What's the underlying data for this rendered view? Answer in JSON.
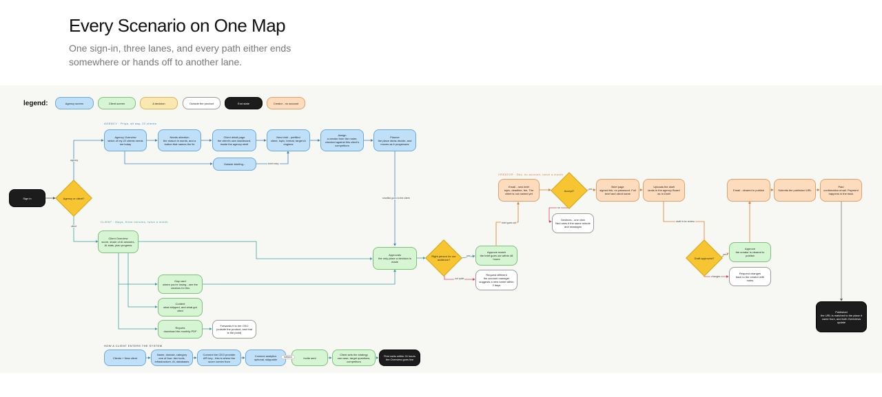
{
  "header": {
    "title": "Every Scenario on One Map",
    "subtitle": "One sign-in, three lanes, and every path either ends somewhere or hands off to another lane."
  },
  "legend": {
    "title": "legend:",
    "items": [
      "Agency screen",
      "Client screen",
      "A decision",
      "Outside the product",
      "End state",
      "Creator - no account"
    ]
  },
  "lanes": {
    "agency": "AGENCY · Priya, all day, 22 clients",
    "client": "CLIENT · Maya, three minutes, twice a month",
    "creator": "CREATOR · Dev, no account, twice a month",
    "how": "HOW A CLIENT ENTERS THE SYSTEM"
  },
  "nodes": {
    "signin": "Sign in",
    "d_agency_client": "Agency or client?",
    "ag_overview": "Agency Overview\nwhich of my 22 clients needs me today",
    "ag_needs": "Needs attention\nthe reason in words, and a button that names the fix",
    "ag_client_detail": "Client detail page\nthe client's own dashboard, inside the agency shell",
    "ag_newbrief": "New brief - prefilled\nclient, topic, format, target AI engines",
    "ag_assign": "Assign\na creator from the roster, checked against this client's competitors",
    "ag_planner": "Planner\nthe place ideas decide, and moves as it progresses",
    "ag_outside": "Outside briefing...",
    "cl_overview": "Client Overview\nscore, share of AI answers, AI stats, plan progress",
    "cl_approvals": "Approvals\nthe only place a decision is made",
    "cl_gap": "Gap card\nwhere you're losing - see the creators for this",
    "cl_content": "Content\nwhat shipped, and what got cited",
    "cl_reports": "Reports\ndownload the monthly PDF",
    "cl_forwards": "Forwards it to her CEO\n(outside the product, and that is the point)",
    "d_right_person": "Right person for our audience?",
    "approve_match": "Approve match\nthe brief goes out within 48 hours",
    "request_diff": "Request different\nthe account manager suggests a new name within 2 days",
    "cr_email": "Email - new brief\ntopic, deadline, fee. The client is not named yet",
    "d_accept": "Accept?",
    "cr_declines": "Declines - one click\nNed sees it the same minute and reassigns",
    "cr_brief_page": "Brief page\nsigned link, no password. Full brief and client name",
    "cr_uploads": "Uploads the draft\nlands in the agency Board as In Draft",
    "d_draft_approved": "Draft approved?",
    "cr_approve": "Approve\nthe creator is cleared to publish",
    "cr_request": "Request changes\nback to the creator with notes",
    "cr_email_publish": "Email - cleared to publish",
    "cr_submit": "Submits the published URL",
    "cr_paid": "Paid\nconfirmation email. Payment happens in the back",
    "cr_published": "Published\nthe URL is matched to the place it came from, and both Overviews update",
    "how1": "Clients + New client",
    "how2": "Name, domain, category\none of four: dev tools, infrastructure, AI, databases",
    "how3": "Connect the CEO provider\nAPI key - this is where the score comes from",
    "how4": "Connect analytics\noptional, skippable",
    "how5": "Invite sent",
    "how6": "Client sets the strategy\nuse case, target questions, competitors",
    "how7": "First radio within 24 hours\nthe Overview goes live"
  },
  "edge_labels": {
    "agency": "agency",
    "client": "client",
    "brief_entry": "brief entry",
    "shortlist": "shortlist goes to the client",
    "yes": "yes",
    "not_quite": "not quite",
    "brief_goes_out": "brief goes out",
    "no": "no",
    "yes2": "yes",
    "draft_review": "draft in for review",
    "yes3": "yes",
    "changes": "changes",
    "fallback": "fallback"
  },
  "colors": {
    "agency": "#bfe0f8",
    "client": "#d6f5d2",
    "decision": "#f6c531",
    "end": "#1c1c1c",
    "creator": "#fddcbd"
  }
}
